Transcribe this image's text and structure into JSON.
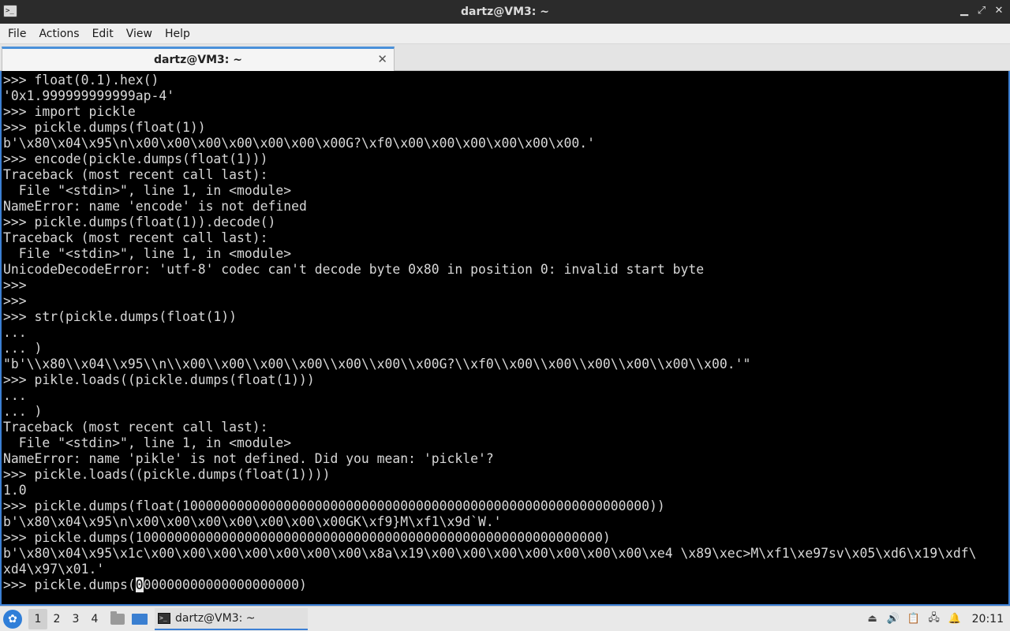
{
  "window": {
    "title": "dartz@VM3: ~",
    "minimize": "▁",
    "maximize": "⤢",
    "close": "✕"
  },
  "menu": {
    "items": [
      "File",
      "Actions",
      "Edit",
      "View",
      "Help"
    ]
  },
  "tab": {
    "label": "dartz@VM3: ~",
    "close": "✕"
  },
  "terminal": {
    "lines": [
      ">>> float(0.1).hex()",
      "'0x1.999999999999ap-4'",
      ">>> import pickle",
      ">>> pickle.dumps(float(1))",
      "b'\\x80\\x04\\x95\\n\\x00\\x00\\x00\\x00\\x00\\x00\\x00G?\\xf0\\x00\\x00\\x00\\x00\\x00\\x00.'",
      ">>> encode(pickle.dumps(float(1)))",
      "Traceback (most recent call last):",
      "  File \"<stdin>\", line 1, in <module>",
      "NameError: name 'encode' is not defined",
      ">>> pickle.dumps(float(1)).decode()",
      "Traceback (most recent call last):",
      "  File \"<stdin>\", line 1, in <module>",
      "UnicodeDecodeError: 'utf-8' codec can't decode byte 0x80 in position 0: invalid start byte",
      ">>>",
      ">>>",
      ">>> str(pickle.dumps(float(1))",
      "...",
      "... )",
      "\"b'\\\\x80\\\\x04\\\\x95\\\\n\\\\x00\\\\x00\\\\x00\\\\x00\\\\x00\\\\x00\\\\x00G?\\\\xf0\\\\x00\\\\x00\\\\x00\\\\x00\\\\x00\\\\x00.'\"",
      ">>> pikle.loads((pickle.dumps(float(1)))",
      "...",
      "... )",
      "Traceback (most recent call last):",
      "  File \"<stdin>\", line 1, in <module>",
      "NameError: name 'pikle' is not defined. Did you mean: 'pickle'?",
      ">>> pickle.loads((pickle.dumps(float(1))))",
      "1.0",
      ">>> pickle.dumps(float(100000000000000000000000000000000000000000000000000000000000))",
      "b'\\x80\\x04\\x95\\n\\x00\\x00\\x00\\x00\\x00\\x00\\x00GK\\xf9}M\\xf1\\x9d`W.'",
      ">>> pickle.dumps(100000000000000000000000000000000000000000000000000000000000)",
      "b'\\x80\\x04\\x95\\x1c\\x00\\x00\\x00\\x00\\x00\\x00\\x00\\x8a\\x19\\x00\\x00\\x00\\x00\\x00\\x00\\x00\\xe4 \\x89\\xec>M\\xf1\\xe97sv\\x05\\xd6\\x19\\xdf\\",
      "xd4\\x97\\x01.'"
    ],
    "prompt_before_cursor": ">>> pickle.dumps(",
    "cursor_char": "0",
    "prompt_after_cursor": "00000000000000000000)"
  },
  "taskbar": {
    "workspaces": [
      "1",
      "2",
      "3",
      "4"
    ],
    "task_label": "dartz@VM3: ~",
    "clock": "20:11"
  }
}
